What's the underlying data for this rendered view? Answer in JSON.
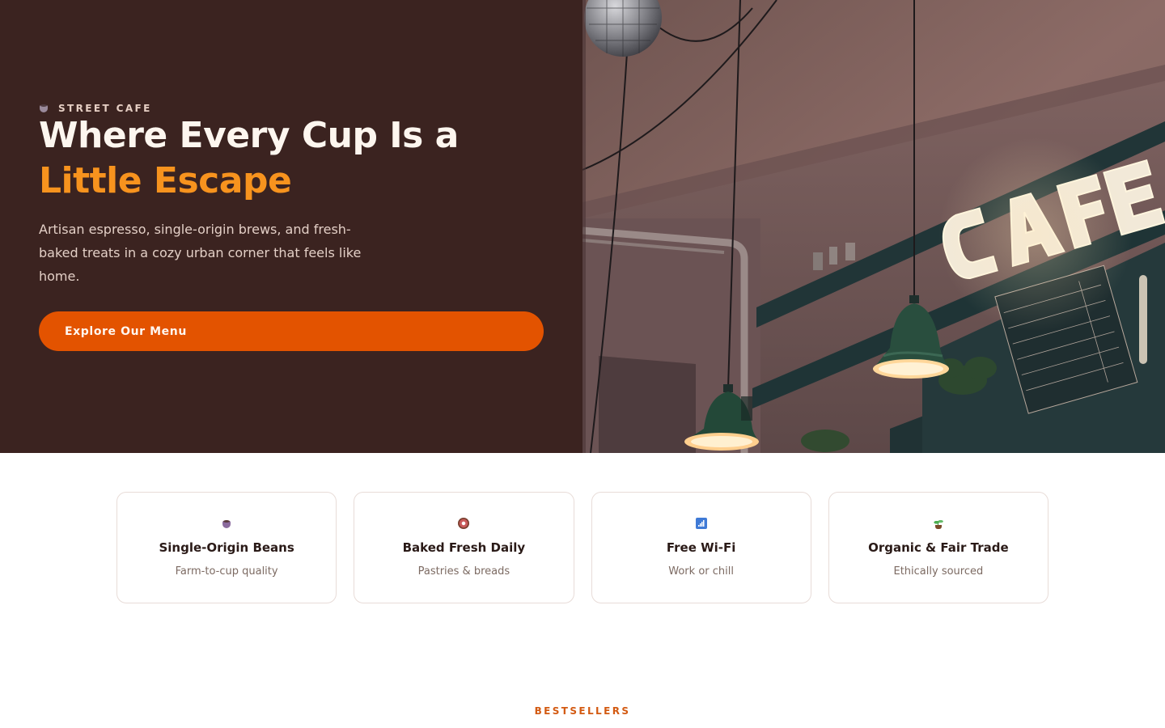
{
  "hero": {
    "eyebrow": "STREET CAFE",
    "eyebrow_icon": "coffee-cup-icon",
    "headline_line1": "Where Every Cup Is a",
    "headline_line2": "Little Escape",
    "subtext": "Artisan espresso, single-origin brews, and fresh-baked treats in a cozy urban corner that feels like home.",
    "cta_label": "Explore Our Menu",
    "image_alt": "Cafe interior with illuminated CAFE marquee sign, pendant lamps and menu board"
  },
  "features": [
    {
      "icon": "coffee-cup-icon",
      "title": "Single-Origin Beans",
      "subtitle": "Farm-to-cup quality"
    },
    {
      "icon": "donut-icon",
      "title": "Baked Fresh Daily",
      "subtitle": "Pastries & breads"
    },
    {
      "icon": "signal-bars-icon",
      "title": "Free Wi-Fi",
      "subtitle": "Work or chill"
    },
    {
      "icon": "seedling-icon",
      "title": "Organic & Fair Trade",
      "subtitle": "Ethically sourced"
    }
  ],
  "bestsellers": {
    "label": "BESTSELLERS"
  },
  "colors": {
    "hero_bg": "#3b2320",
    "headline_accent": "#f7931e",
    "cta_bg": "#e35300",
    "section_label": "#d35a12",
    "card_border": "#e8dcd8"
  }
}
